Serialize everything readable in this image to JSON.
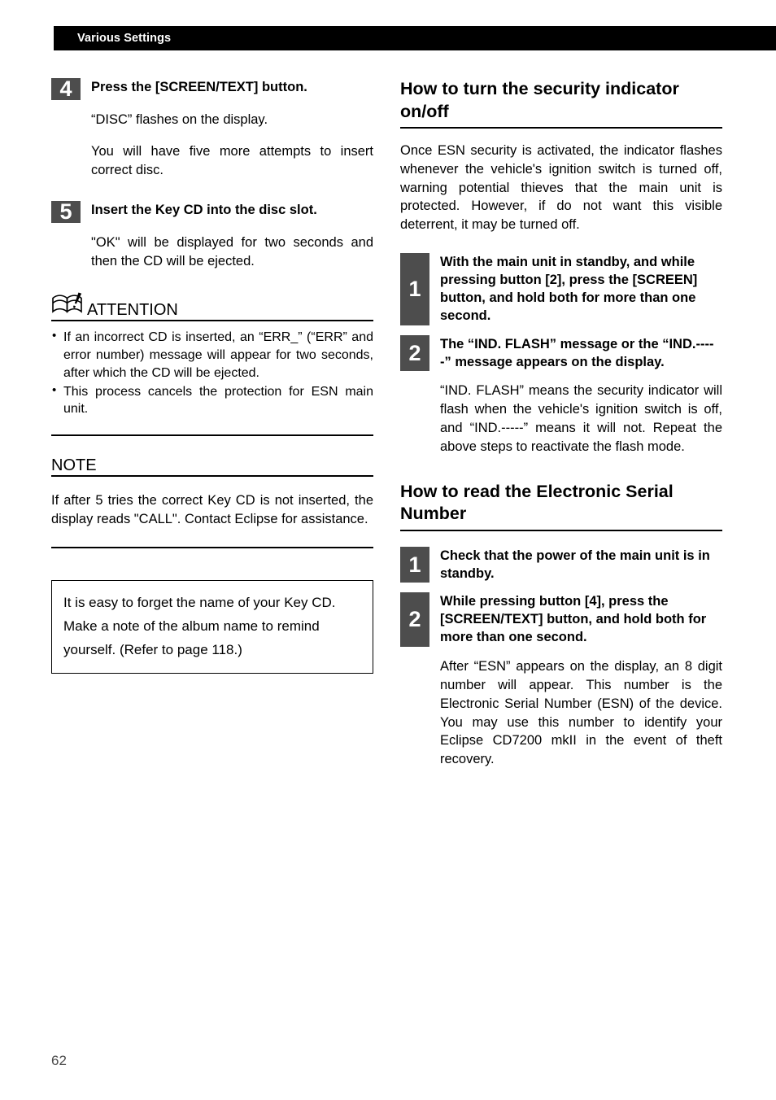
{
  "header": {
    "title": "Various Settings"
  },
  "left_column": {
    "step4": {
      "number": "4",
      "title": "Press the [SCREEN/TEXT] button.",
      "paragraphs": [
        "“DISC” flashes on the display.",
        "You will have five more attempts to insert correct disc."
      ]
    },
    "step5": {
      "number": "5",
      "title": "Insert the Key CD into the disc slot.",
      "paragraphs": [
        "\"OK\" will be displayed for two seconds and then the CD will be ejected."
      ]
    },
    "attention": {
      "icon": "open-book-exclamation-icon",
      "label": "ATTENTION",
      "bullets": [
        "If an incorrect CD is inserted, an “ERR_” (“ERR” and error number) message will appear for two seconds, after which the CD will be ejected.",
        "This process cancels the protection for ESN main unit."
      ]
    },
    "note": {
      "label": "NOTE",
      "text": "If after 5 tries the correct Key CD is not inserted, the display reads \"CALL\". Contact Eclipse for assistance."
    },
    "tip_box": {
      "text": "It is easy to forget the name of your Key CD. Make a note of the album name to remind yourself. (Refer to page 118.)"
    }
  },
  "right_column": {
    "section1": {
      "heading": "How to turn the security indicator on/off",
      "intro": "Once ESN security is activated, the indicator flashes whenever the vehicle's ignition switch is turned off, warning potential thieves that the main unit is protected. However, if do not want this visible deterrent, it may be turned off.",
      "step1": {
        "number": "1",
        "title": "With the main unit in standby, and while pressing button [2], press the [SCREEN] button, and hold both for more than one second."
      },
      "step2": {
        "number": "2",
        "title": "The “IND. FLASH” message or the “IND.-----” message appears on the display.",
        "body": "“IND. FLASH” means the security indicator will flash when the vehicle's ignition switch is off, and “IND.-----” means it will not. Repeat the above steps to reactivate the flash mode."
      }
    },
    "section2": {
      "heading": "How to read the Electronic Serial Number",
      "step1": {
        "number": "1",
        "title": "Check that the power of the main unit is in standby."
      },
      "step2": {
        "number": "2",
        "title": "While pressing button [4], press the [SCREEN/TEXT] button, and hold both for more than one second.",
        "body": "After “ESN” appears on the display, an 8 digit number will appear. This number is the Electronic Serial Number (ESN) of the device. You may use this number to identify your Eclipse CD7200 mkII in the event of theft recovery."
      }
    }
  },
  "footer": {
    "page_number": "62"
  },
  "colors": {
    "header_bar": "#000000",
    "step_number_box": "#4d4d4d",
    "text": "#000000",
    "page_number": "#4a4a4a"
  }
}
